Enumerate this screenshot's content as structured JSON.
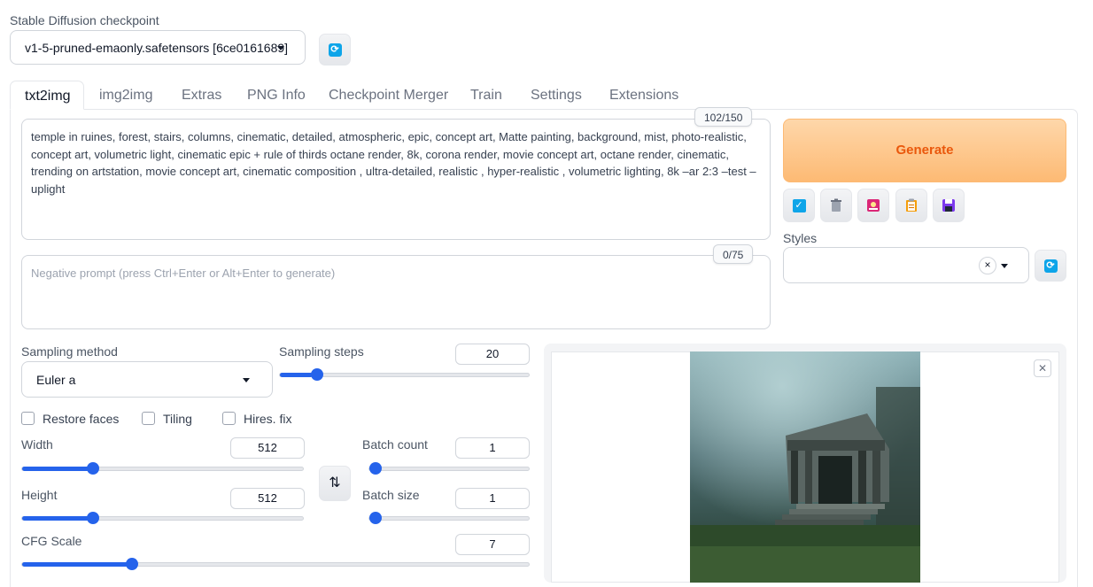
{
  "checkpoint": {
    "label": "Stable Diffusion checkpoint",
    "value": "v1-5-pruned-emaonly.safetensors [6ce0161689]"
  },
  "tabs": [
    {
      "label": "txt2img",
      "active": true
    },
    {
      "label": "img2img"
    },
    {
      "label": "Extras"
    },
    {
      "label": "PNG Info"
    },
    {
      "label": "Checkpoint Merger"
    },
    {
      "label": "Train"
    },
    {
      "label": "Settings"
    },
    {
      "label": "Extensions"
    }
  ],
  "prompt": {
    "text": "temple in ruines, forest, stairs, columns, cinematic, detailed, atmospheric, epic, concept art, Matte painting, background, mist, photo-realistic, concept art, volumetric light, cinematic epic + rule of thirds octane render, 8k, corona render, movie concept art, octane render, cinematic, trending on artstation, movie concept art, cinematic composition , ultra-detailed, realistic , hyper-realistic , volumetric lighting, 8k –ar 2:3 –test –uplight",
    "counter": "102/150"
  },
  "negative_prompt": {
    "placeholder": "Negative prompt (press Ctrl+Enter or Alt+Enter to generate)",
    "counter": "0/75"
  },
  "generate_label": "Generate",
  "tool_icons": [
    "apply-style-icon",
    "trash-icon",
    "image-icon",
    "clipboard-icon",
    "save-icon"
  ],
  "styles": {
    "label": "Styles",
    "clear": "×"
  },
  "sampling": {
    "method_label": "Sampling method",
    "method_value": "Euler a",
    "steps_label": "Sampling steps",
    "steps_value": "20",
    "steps_fraction": 0.13
  },
  "options": {
    "restore_faces": "Restore faces",
    "tiling": "Tiling",
    "hires_fix": "Hires. fix"
  },
  "width": {
    "label": "Width",
    "value": "512",
    "fraction": 0.24
  },
  "height": {
    "label": "Height",
    "value": "512",
    "fraction": 0.24
  },
  "batch_count": {
    "label": "Batch count",
    "value": "1",
    "fraction": 0.0
  },
  "batch_size": {
    "label": "Batch size",
    "value": "1",
    "fraction": 0.0
  },
  "cfg_scale": {
    "label": "CFG Scale",
    "value": "7",
    "fraction": 0.21
  },
  "swap_symbol": "⇅",
  "colors": {
    "accent": "#2563eb",
    "generate_text": "#ea580c",
    "generate_bg": "#fdba74"
  }
}
